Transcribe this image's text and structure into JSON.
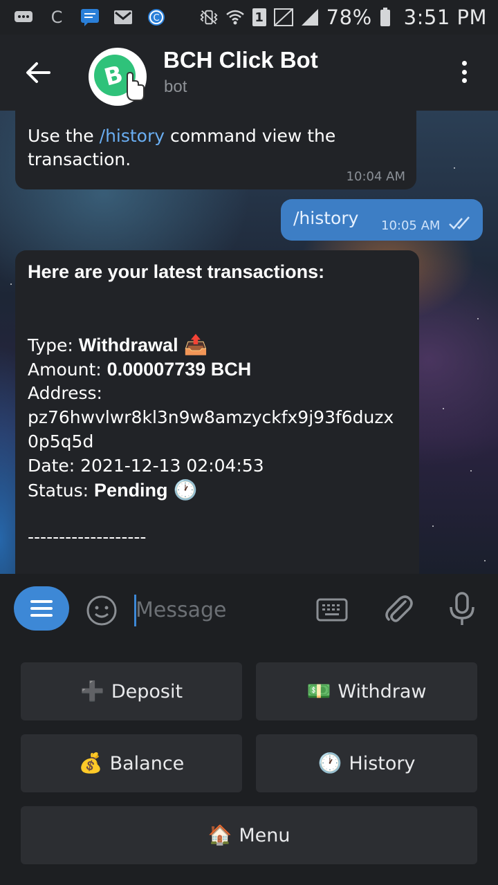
{
  "status_bar": {
    "carrier_letter": "C",
    "sim_slot": "1",
    "battery": "78%",
    "time": "3:51 PM",
    "icons": [
      "chat-bubble-icon",
      "gmail-icon",
      "app-c-icon",
      "vibrate-icon",
      "wifi-icon",
      "sim-icon",
      "no-signal-icon",
      "signal-icon",
      "battery-icon"
    ]
  },
  "header": {
    "title": "BCH Click Bot",
    "subtitle": "bot",
    "avatar_color": "#2fc27a"
  },
  "messages": {
    "m1": {
      "prefix": "Use the ",
      "command": "/history",
      "suffix": " command view the transaction.",
      "time": "10:04 AM"
    },
    "m2": {
      "text": "/history",
      "time": "10:05 AM"
    },
    "m3": {
      "heading": "Here are your latest transactions:",
      "type_label": "Type: ",
      "type_value": "Withdrawal",
      "type_emoji": "📤",
      "amount_label": "Amount: ",
      "amount_value": "0.00007739 BCH",
      "address_label": "Address:",
      "address_line1": "pz76hwvlwr8kl3n9w8amzyckfx9j93f6duzx",
      "address_line2": "0p5q5d",
      "date_label": "Date: ",
      "date_value": "2021-12-13 02:04:53",
      "status_label": "Status: ",
      "status_value": "Pending",
      "status_emoji": "🕐",
      "divider": "-------------------"
    }
  },
  "composer": {
    "placeholder": "Message"
  },
  "keyboard": {
    "deposit": {
      "emoji": "➕",
      "label": "Deposit"
    },
    "withdraw": {
      "emoji": "💵",
      "label": "Withdraw"
    },
    "balance": {
      "emoji": "💰",
      "label": "Balance"
    },
    "history": {
      "emoji": "🕐",
      "label": "History"
    },
    "menu": {
      "emoji": "🏠",
      "label": "Menu"
    }
  },
  "colors": {
    "accent": "#3d88d6",
    "outgoing_bubble": "#3d7ec5",
    "incoming_bubble": "#212327",
    "link": "#6aaef2"
  }
}
